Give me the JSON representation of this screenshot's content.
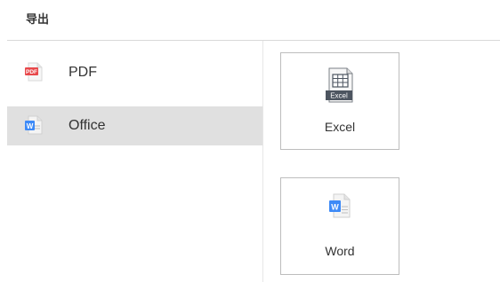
{
  "dialog": {
    "title": "导出"
  },
  "sidebar": {
    "items": [
      {
        "label": "PDF",
        "icon": "pdf-file-icon",
        "icon_badge": "PDF",
        "selected": false
      },
      {
        "label": "Office",
        "icon": "word-file-icon",
        "icon_badge": "W",
        "selected": true
      }
    ]
  },
  "options": {
    "excel": {
      "label": "Excel",
      "icon": "excel-spreadsheet-icon",
      "icon_badge": "Excel"
    },
    "word": {
      "label": "Word",
      "icon": "word-document-icon",
      "icon_badge": "W"
    }
  },
  "colors": {
    "pdf_red": "#e8484b",
    "word_blue": "#3d8af7",
    "excel_dark": "#4d5560",
    "selected_bg": "#e0e0e0",
    "border": "#bdbdbd"
  }
}
